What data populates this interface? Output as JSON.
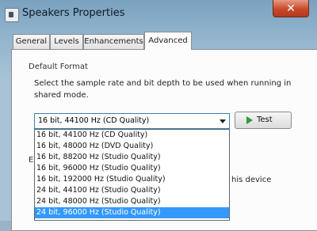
{
  "window": {
    "title": "Speakers Properties",
    "close_label": "✕"
  },
  "tabs": [
    {
      "label": "General",
      "active": false
    },
    {
      "label": "Levels",
      "active": false
    },
    {
      "label": "Enhancements",
      "active": false
    },
    {
      "label": "Advanced",
      "active": true
    }
  ],
  "default_format": {
    "group_label": "Default Format",
    "description": "Select the sample rate and bit depth to be used when running in shared mode.",
    "selected_value": "16 bit, 44100 Hz (CD Quality)",
    "test_label": "Test",
    "options": [
      {
        "label": "16 bit, 44100 Hz (CD Quality)",
        "selected": false
      },
      {
        "label": "16 bit, 48000 Hz (DVD Quality)",
        "selected": false
      },
      {
        "label": "16 bit, 88200 Hz (Studio Quality)",
        "selected": false
      },
      {
        "label": "16 bit, 96000 Hz (Studio Quality)",
        "selected": false
      },
      {
        "label": "16 bit, 192000 Hz (Studio Quality)",
        "selected": false
      },
      {
        "label": "24 bit, 44100 Hz (Studio Quality)",
        "selected": false
      },
      {
        "label": "24 bit, 48000 Hz (Studio Quality)",
        "selected": false
      },
      {
        "label": "24 bit, 96000 Hz (Studio Quality)",
        "selected": true
      }
    ]
  },
  "obscured": {
    "partial_letter": "E",
    "partial_text": "his device"
  },
  "colors": {
    "selection": "#3399ff",
    "close_button": "#c9482a",
    "test_icon": "#2f9a3c"
  }
}
